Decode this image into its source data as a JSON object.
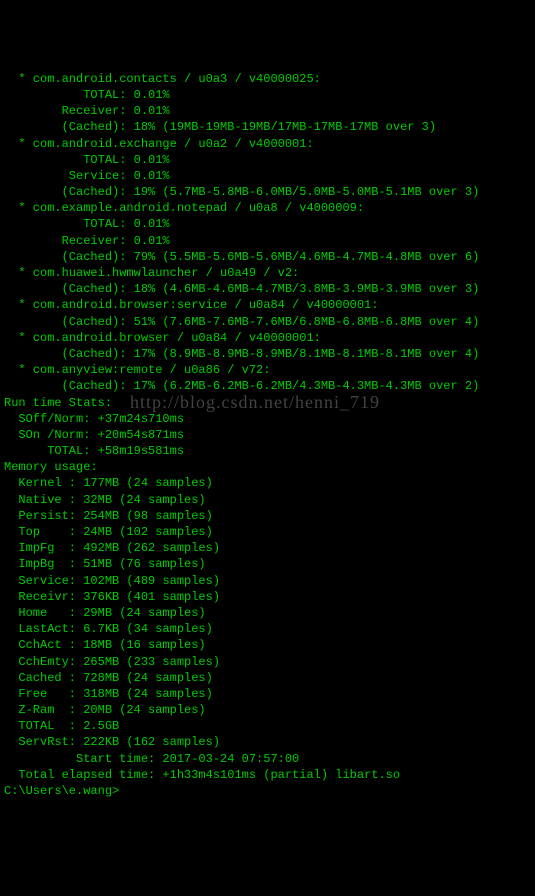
{
  "processes": [
    {
      "header": "  * com.android.contacts / u0a3 / v40000025:",
      "lines": [
        "           TOTAL: 0.01%",
        "        Receiver: 0.01%",
        "        (Cached): 18% (19MB-19MB-19MB/17MB-17MB-17MB over 3)"
      ]
    },
    {
      "header": "  * com.android.exchange / u0a2 / v4000001:",
      "lines": [
        "           TOTAL: 0.01%",
        "         Service: 0.01%",
        "        (Cached): 19% (5.7MB-5.8MB-6.0MB/5.0MB-5.0MB-5.1MB over 3)"
      ]
    },
    {
      "header": "  * com.example.android.notepad / u0a8 / v4000009:",
      "lines": [
        "           TOTAL: 0.01%",
        "        Receiver: 0.01%",
        "        (Cached): 79% (5.5MB-5.6MB-5.6MB/4.6MB-4.7MB-4.8MB over 6)"
      ]
    },
    {
      "header": "  * com.huawei.hwmwlauncher / u0a49 / v2:",
      "lines": [
        "        (Cached): 18% (4.6MB-4.6MB-4.7MB/3.8MB-3.9MB-3.9MB over 3)"
      ]
    },
    {
      "header": "  * com.android.browser:service / u0a84 / v40000001:",
      "lines": [
        "        (Cached): 51% (7.6MB-7.6MB-7.6MB/6.8MB-6.8MB-6.8MB over 4)"
      ]
    },
    {
      "header": "  * com.android.browser / u0a84 / v40000001:",
      "lines": [
        "        (Cached): 17% (8.9MB-8.9MB-8.9MB/8.1MB-8.1MB-8.1MB over 4)"
      ]
    },
    {
      "header": "  * com.anyview:remote / u0a86 / v72:",
      "lines": [
        "        (Cached): 17% (6.2MB-6.2MB-6.2MB/4.3MB-4.3MB-4.3MB over 2)"
      ]
    }
  ],
  "runtime": {
    "title": "Run time Stats:",
    "lines": [
      "  SOff/Norm: +37m24s710ms",
      "  SOn /Norm: +20m54s871ms",
      "      TOTAL: +58m19s581ms"
    ]
  },
  "memory": {
    "title": "Memory usage:",
    "lines": [
      "  Kernel : 177MB (24 samples)",
      "  Native : 32MB (24 samples)",
      "  Persist: 254MB (98 samples)",
      "  Top    : 24MB (102 samples)",
      "  ImpFg  : 492MB (262 samples)",
      "  ImpBg  : 51MB (76 samples)",
      "  Service: 102MB (489 samples)",
      "  Receivr: 376KB (401 samples)",
      "  Home   : 29MB (24 samples)",
      "  LastAct: 6.7KB (34 samples)",
      "  CchAct : 18MB (16 samples)",
      "  CchEmty: 265MB (233 samples)",
      "  Cached : 728MB (24 samples)",
      "  Free   : 318MB (24 samples)",
      "  Z-Ram  : 20MB (24 samples)",
      "  TOTAL  : 2.5GB",
      "  ServRst: 222KB (162 samples)"
    ]
  },
  "footer": {
    "start": "          Start time: 2017-03-24 07:57:00",
    "elapsed": "  Total elapsed time: +1h33m4s101ms (partial) libart.so"
  },
  "prompt": "C:\\Users\\e.wang>",
  "watermark": "http://blog.csdn.net/henni_719"
}
